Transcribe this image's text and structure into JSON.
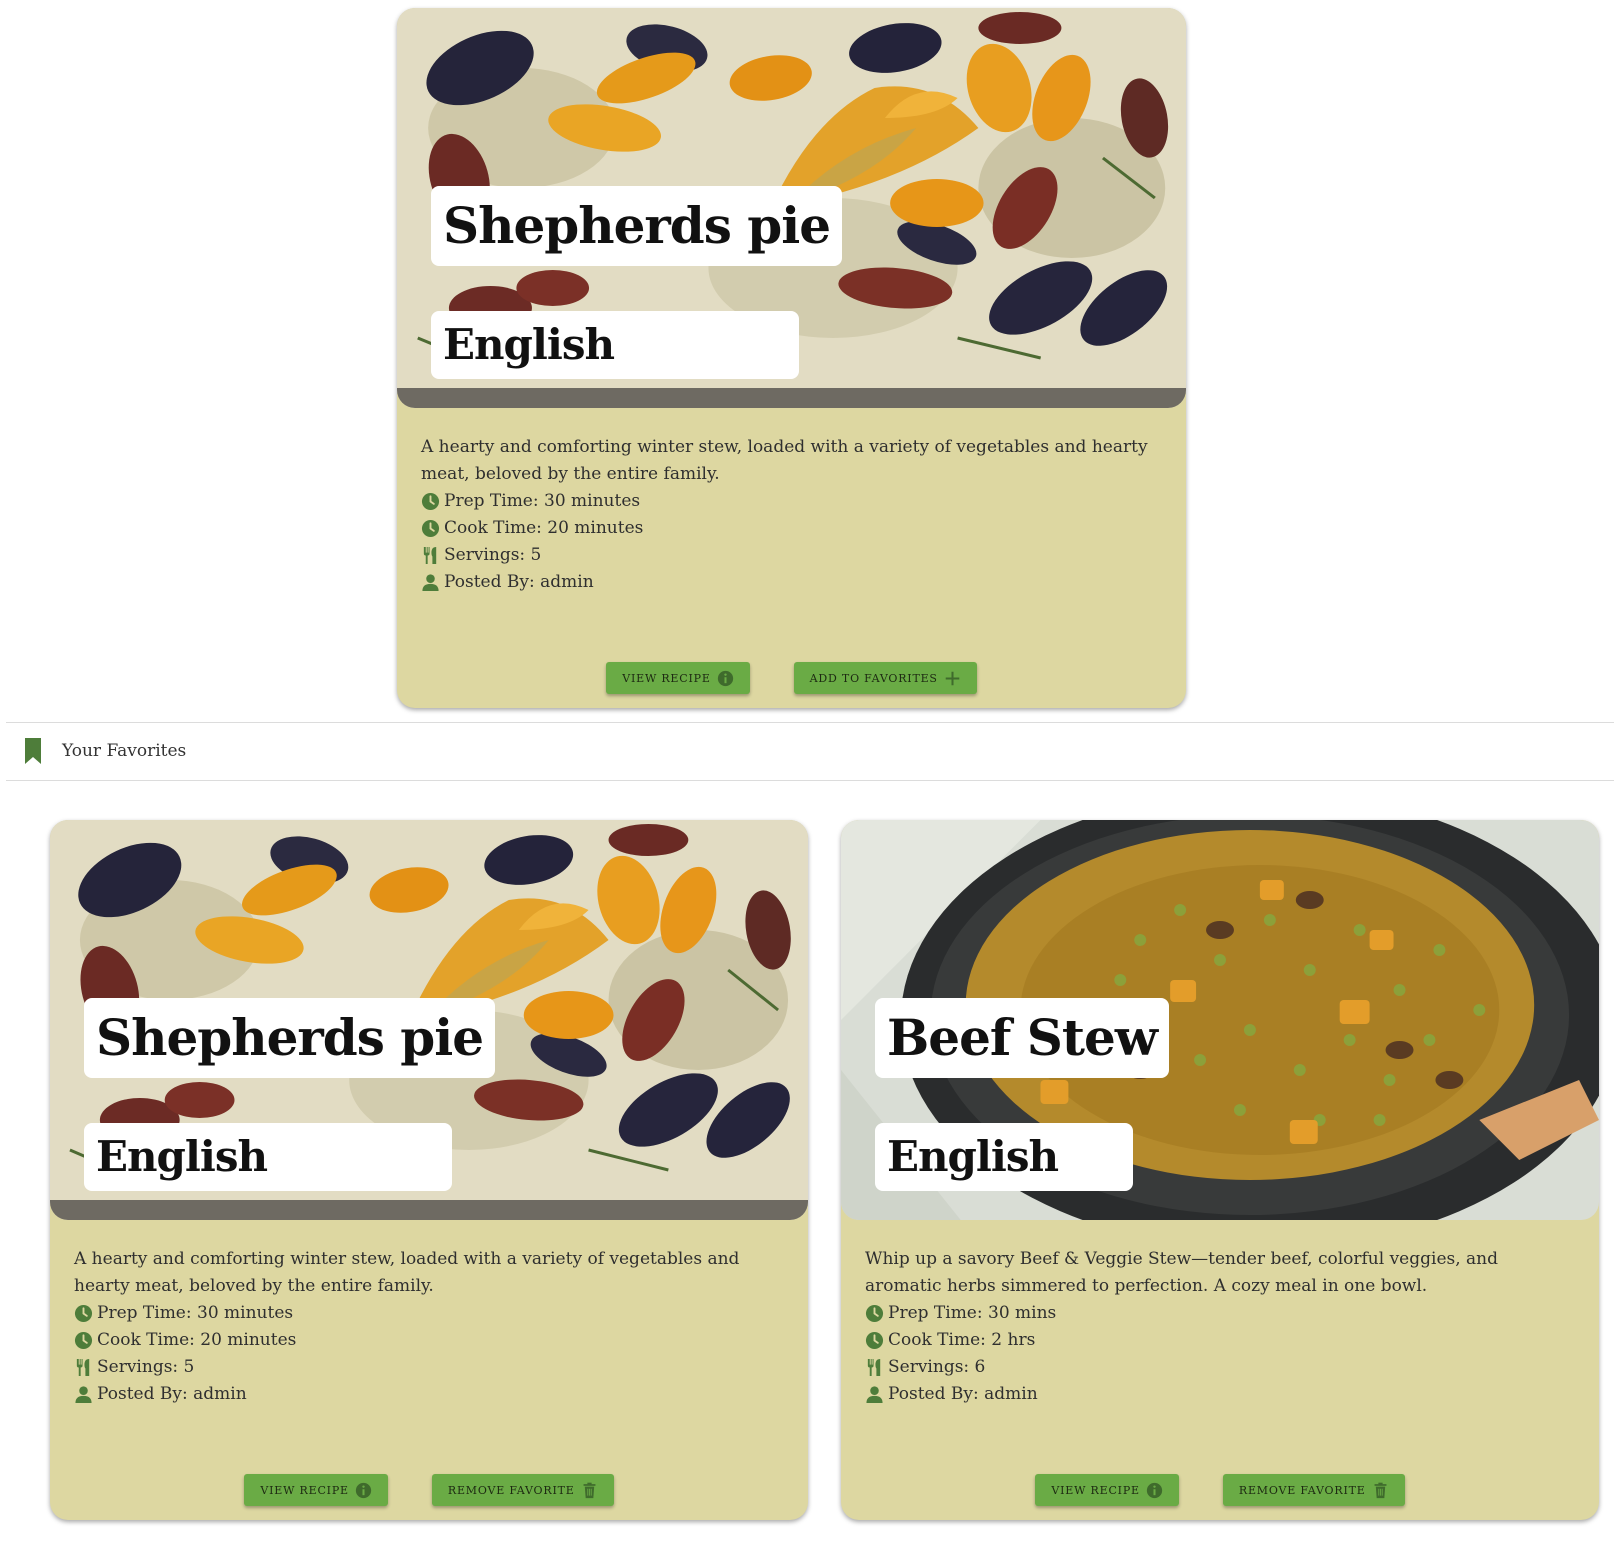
{
  "featured": {
    "title": "Shepherds pie",
    "cuisine": "English",
    "description": "A hearty and comforting winter stew, loaded with a variety of vegetables and hearty meat, beloved by the entire family.",
    "prep": "Prep Time: 30 minutes",
    "cook": "Cook Time: 20 minutes",
    "servings": "Servings: 5",
    "posted_by": "Posted By: admin",
    "view_label": "VIEW RECIPE",
    "fav_label": "ADD TO FAVORITES"
  },
  "favorites_header": {
    "label": "Your Favorites",
    "icon": "bookmark-icon"
  },
  "favorites": [
    {
      "title": "Shepherds pie",
      "cuisine": "English",
      "description": "A hearty and comforting winter stew, loaded with a variety of vegetables and hearty meat, beloved by the entire family.",
      "prep": "Prep Time: 30 minutes",
      "cook": "Cook Time: 20 minutes",
      "servings": "Servings: 5",
      "posted_by": "Posted By: admin",
      "view_label": "VIEW RECIPE",
      "remove_label": "REMOVE FAVORITE"
    },
    {
      "title": "Beef Stew",
      "cuisine": "English",
      "description": "Whip up a savory Beef & Veggie Stew—tender beef, colorful veggies, and aromatic herbs simmered to perfection. A cozy meal in one bowl.",
      "prep": "Prep Time: 30 mins",
      "cook": "Cook Time: 2 hrs",
      "servings": "Servings: 6",
      "posted_by": "Posted By: admin",
      "view_label": "VIEW RECIPE",
      "remove_label": "REMOVE FAVORITE"
    }
  ],
  "colors": {
    "card_bg": "#ddd7a1",
    "button_bg": "#6aab45",
    "icon_green": "#4e7d3a"
  }
}
